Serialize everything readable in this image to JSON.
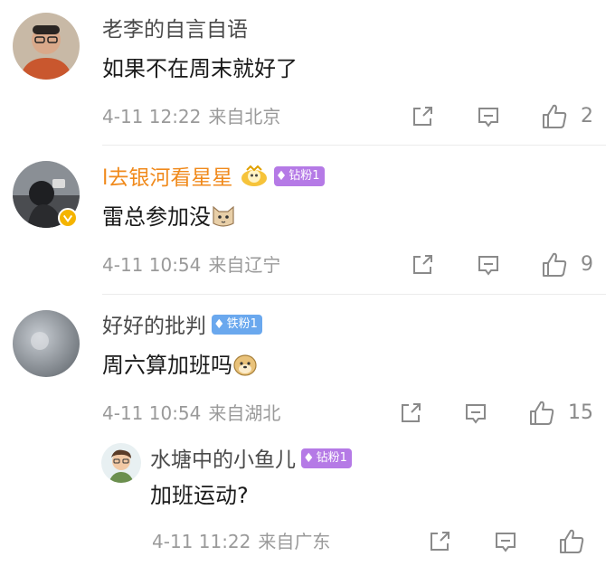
{
  "comments": [
    {
      "username": "老李的自言自语",
      "text": "如果不在周末就好了",
      "time": "4-11 12:22",
      "location": "来自北京",
      "likes": "2"
    },
    {
      "username": "l去银河看星星",
      "badge": "钻粉1",
      "text": "雷总参加没",
      "time": "4-11 10:54",
      "location": "来自辽宁",
      "likes": "9"
    },
    {
      "username": "好好的批判",
      "badge": "铁粉1",
      "text": "周六算加班吗",
      "time": "4-11 10:54",
      "location": "来自湖北",
      "likes": "15"
    }
  ],
  "reply": {
    "username": "水塘中的小鱼儿",
    "badge": "钻粉1",
    "text": "加班运动?",
    "time": "4-11 11:22",
    "location": "来自广东"
  },
  "icons": {
    "share": "share-icon",
    "comment": "comment-icon",
    "like": "like-icon",
    "verified": "verified-icon",
    "gem": "diamond-icon"
  },
  "colors": {
    "orange_name": "#f08a1c",
    "badge_purple": "#b57ae6",
    "badge_blue": "#6aa8ee",
    "verified": "#f5b400"
  }
}
